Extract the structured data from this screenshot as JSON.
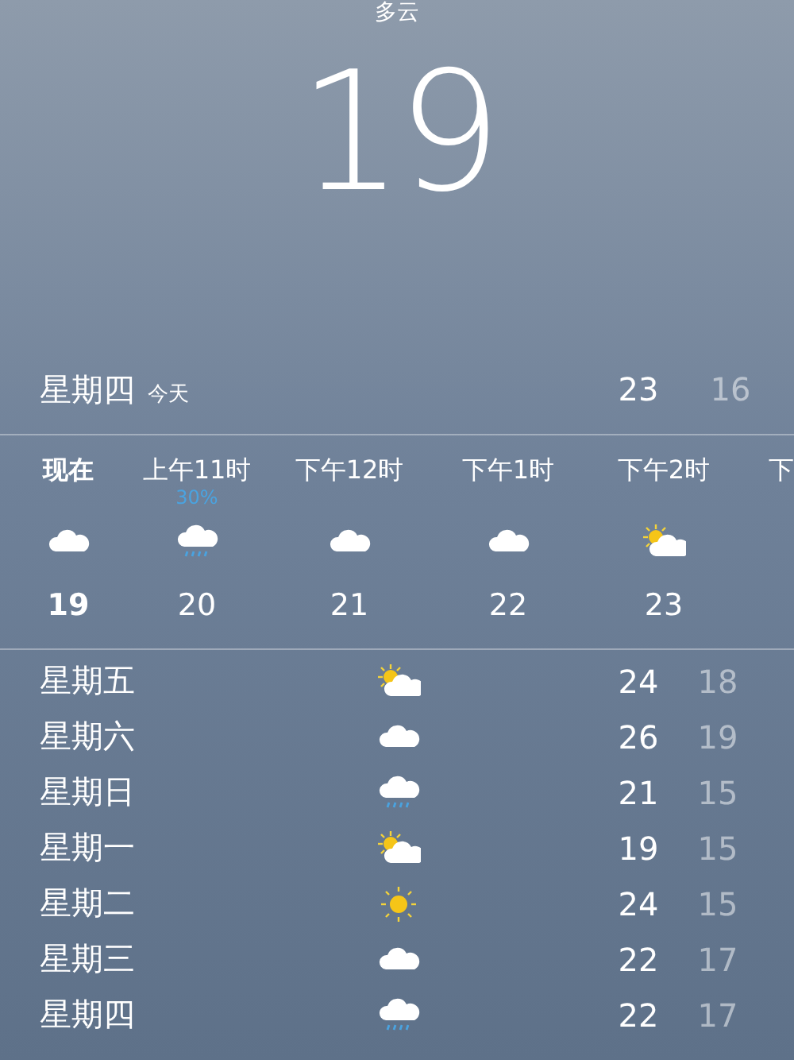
{
  "condition": "多云",
  "current_temp": "19",
  "today": {
    "day": "星期四",
    "label": "今天",
    "high": "23",
    "low": "16"
  },
  "hourly": [
    {
      "time": "现在",
      "temp": "19",
      "kind": "cloud",
      "now": true
    },
    {
      "time": "上午11时",
      "chance": "30%",
      "temp": "20",
      "kind": "rain",
      "now": false
    },
    {
      "time": "下午12时",
      "temp": "21",
      "kind": "cloud",
      "now": false
    },
    {
      "time": "下午1时",
      "temp": "22",
      "kind": "cloud",
      "now": false
    },
    {
      "time": "下午2时",
      "temp": "23",
      "kind": "partly-sunny",
      "now": false
    },
    {
      "time": "下",
      "now": false
    }
  ],
  "daily": [
    {
      "day": "星期五",
      "kind": "partly-sunny",
      "high": "24",
      "low": "18"
    },
    {
      "day": "星期六",
      "kind": "cloud",
      "high": "26",
      "low": "19"
    },
    {
      "day": "星期日",
      "kind": "rain",
      "high": "21",
      "low": "15"
    },
    {
      "day": "星期一",
      "kind": "partly-sunny",
      "high": "19",
      "low": "15"
    },
    {
      "day": "星期二",
      "kind": "sun",
      "high": "24",
      "low": "15"
    },
    {
      "day": "星期三",
      "kind": "cloud",
      "high": "22",
      "low": "17"
    },
    {
      "day": "星期四",
      "kind": "rain",
      "high": "22",
      "low": "17"
    }
  ]
}
